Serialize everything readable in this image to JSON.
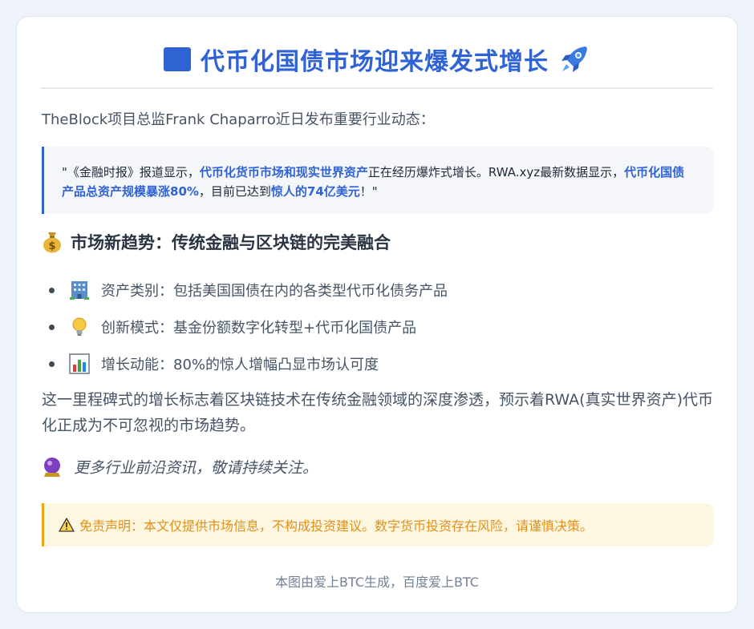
{
  "title": "代币化国债市场迎来爆发式增长",
  "intro": "TheBlock项目总监Frank Chaparro近日发布重要行业动态：",
  "quote": {
    "parts": [
      {
        "text": "\"《金融时报》报道显示，",
        "hl": false
      },
      {
        "text": "代币化货币市场和现实世界资产",
        "hl": true
      },
      {
        "text": "正在经历爆炸式增长。RWA.xyz最新数据显示，",
        "hl": false
      },
      {
        "text": "代币化国债产品总资产规模暴涨80%",
        "hl": true
      },
      {
        "text": "，目前已达到",
        "hl": false
      },
      {
        "text": "惊人的74亿美元",
        "hl": true
      },
      {
        "text": "！\"",
        "hl": false
      }
    ]
  },
  "section_title": "市场新趋势：传统金融与区块链的完美融合",
  "bullets": [
    {
      "icon": "office-building-icon",
      "label": "资产类别：包括美国国债在内的各类型代币化债务产品"
    },
    {
      "icon": "light-bulb-icon",
      "label": "创新模式：基金份额数字化转型+代币化国债产品"
    },
    {
      "icon": "bar-chart-icon",
      "label": "增长动能：80%的惊人增幅凸显市场认可度"
    }
  ],
  "paragraph": "这一里程碑式的增长标志着区块链技术在传统金融领域的深度渗透，预示着RWA(真实世界资产)代币化正成为不可忽视的市场趋势。",
  "more": "更多行业前沿资讯，敬请持续关注。",
  "disclaimer": "免责声明：本文仅提供市场信息，不构成投资建议。数字货币投资存在风险，请谨慎决策。",
  "footer": "本图由爱上BTC生成，百度爱上BTC",
  "colors": {
    "accent": "#2f63d4",
    "warning": "#f0a41c"
  }
}
